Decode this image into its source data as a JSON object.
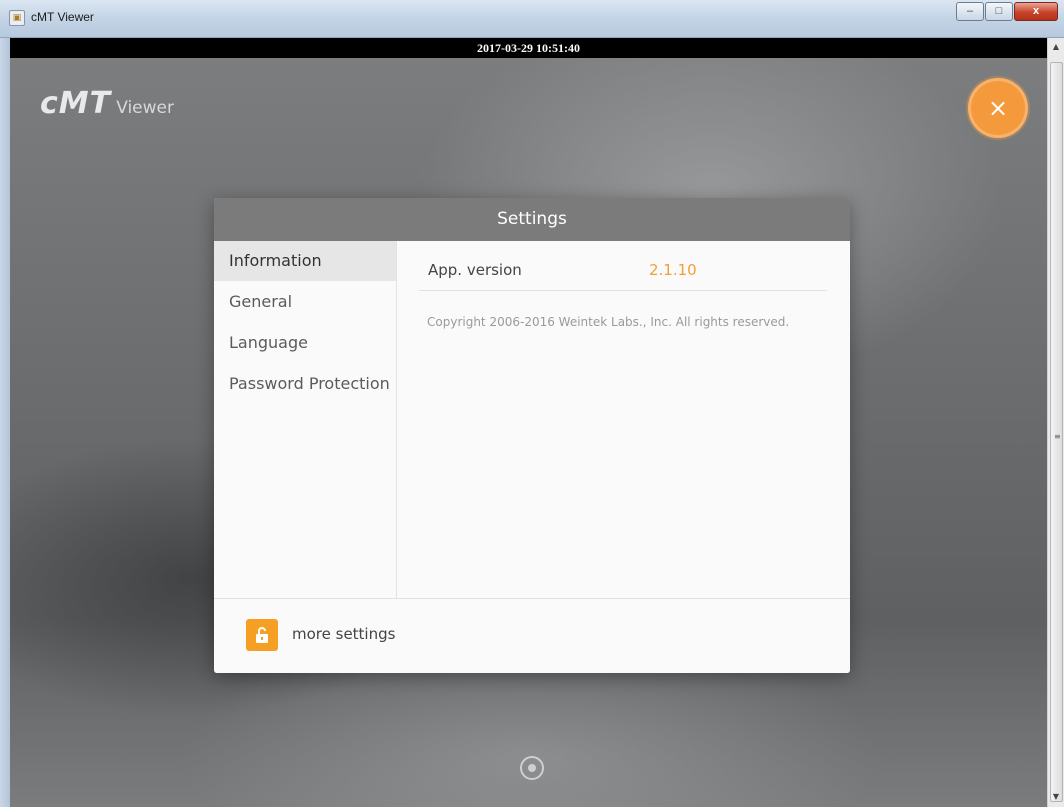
{
  "window": {
    "title": "cMT Viewer",
    "minimize_glyph": "–",
    "maximize_glyph": "□",
    "close_glyph": "x"
  },
  "timestamp": "2017-03-29 10:51:40",
  "logo": {
    "main": "cMT",
    "sub": "Viewer"
  },
  "close_button": {
    "glyph": "×",
    "color": "#f49a3c"
  },
  "settings": {
    "title": "Settings",
    "menu": [
      {
        "label": "Information",
        "active": true
      },
      {
        "label": "General",
        "active": false
      },
      {
        "label": "Language",
        "active": false
      },
      {
        "label": "Password Protection",
        "active": false
      }
    ],
    "info": {
      "label": "App. version",
      "value": "2.1.10",
      "copyright": "Copyright 2006-2016 Weintek Labs., Inc. All rights reserved."
    },
    "footer": {
      "more_label": "more settings",
      "lock_icon": "unlock-icon",
      "accent": "#f5a024"
    }
  },
  "colors": {
    "accent": "#f0a03a",
    "header": "#7b7b7b"
  }
}
